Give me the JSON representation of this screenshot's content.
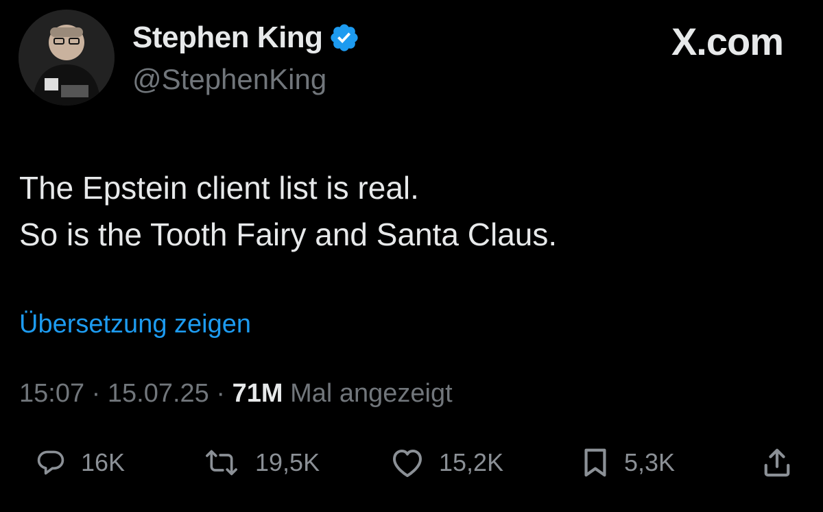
{
  "author": {
    "name": "Stephen King",
    "handle": "@StephenKing",
    "verified": true,
    "avatar_icon": "avatar"
  },
  "brand": {
    "label": "X.com"
  },
  "tweet": {
    "lines": [
      "The Epstein client list is real.",
      "So is the Tooth Fairy and Santa Claus."
    ],
    "translate_label": "Übersetzung zeigen"
  },
  "meta": {
    "time": "15:07",
    "separator": "·",
    "date": "15.07.25",
    "views_count": "71M",
    "views_label": "Mal angezeigt"
  },
  "actions": {
    "replies": {
      "icon": "reply-icon",
      "count": "16K"
    },
    "reposts": {
      "icon": "repost-icon",
      "count": "19,5K"
    },
    "likes": {
      "icon": "heart-icon",
      "count": "15,2K"
    },
    "bookmarks": {
      "icon": "bookmark-icon",
      "count": "5,3K"
    },
    "share": {
      "icon": "share-icon"
    }
  },
  "colors": {
    "background": "#000000",
    "text_primary": "#e7e9ea",
    "text_secondary": "#71767b",
    "accent": "#1d9bf0"
  }
}
